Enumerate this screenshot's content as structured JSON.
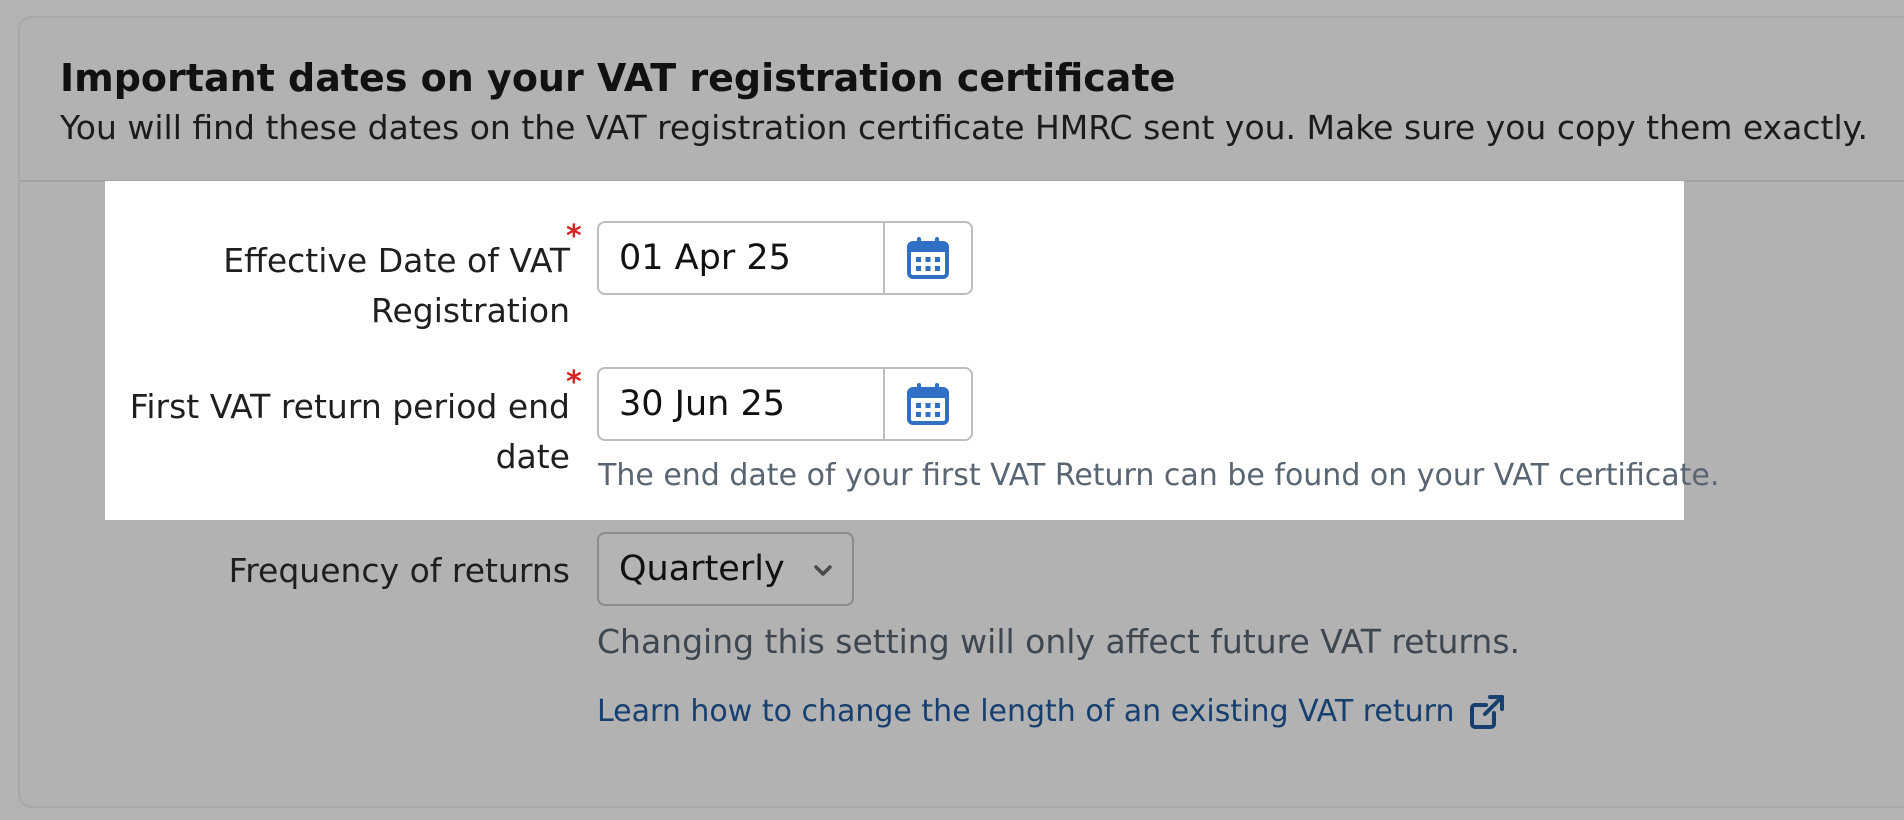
{
  "section": {
    "title": "Important dates on your VAT registration certificate",
    "subtitle": "You will find these dates on the VAT registration certificate HMRC sent you. Make sure you copy them exactly."
  },
  "fields": {
    "effective_date": {
      "label_line1": "Effective Date of VAT",
      "label_line2": "Registration",
      "required_mark": "*",
      "value": "01 Apr 25",
      "button_icon": "calendar-icon"
    },
    "first_return_end": {
      "label_line1": "First VAT return period end",
      "label_line2": "date",
      "required_mark": "*",
      "value": "30 Jun 25",
      "button_icon": "calendar-icon",
      "hint": "The end date of your first VAT Return can be found on your VAT certificate."
    },
    "frequency": {
      "label": "Frequency of returns",
      "selected": "Quarterly",
      "hint": "Changing this setting will only affect future VAT returns.",
      "link_text": "Learn how to change the length of an existing VAT return",
      "link_icon": "external-link-icon"
    }
  },
  "colors": {
    "overlay": "#b3b3b3",
    "required": "#d32424",
    "calendar_icon": "#2f6fc4",
    "link": "#173f6f"
  }
}
